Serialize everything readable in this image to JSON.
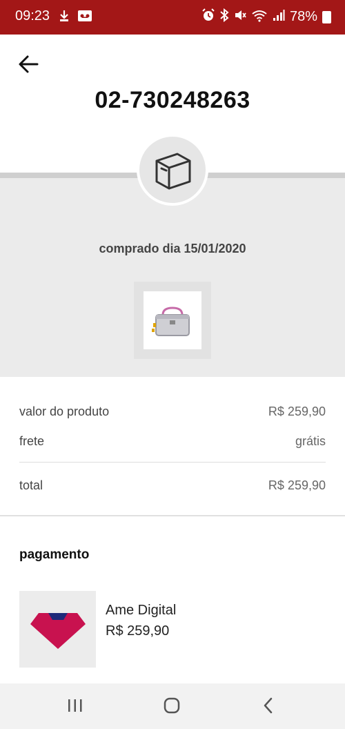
{
  "status_bar": {
    "time": "09:23",
    "battery": "78%",
    "left_icons": [
      "download-icon",
      "voicemail-icon"
    ],
    "right_icons": [
      "alarm-icon",
      "bluetooth-icon",
      "mute-icon",
      "wifi-icon",
      "signal-icon",
      "battery-icon"
    ]
  },
  "header": {
    "order_number": "02-730248263"
  },
  "order": {
    "purchase_date_text": "comprado dia 15/01/2020",
    "icon": "package-icon"
  },
  "summary": {
    "rows": [
      {
        "label": "valor do produto",
        "value": "R$ 259,90"
      },
      {
        "label": "frete",
        "value": "grátis"
      },
      {
        "label": "total",
        "value": "R$ 259,90"
      }
    ]
  },
  "payment": {
    "title": "pagamento",
    "method": "Ame Digital",
    "amount": "R$ 259,90"
  },
  "colors": {
    "status_bar": "#a31717",
    "hero_bg": "#ebebeb",
    "ame_pink": "#c8124f",
    "ame_navy": "#1f2a7a"
  }
}
